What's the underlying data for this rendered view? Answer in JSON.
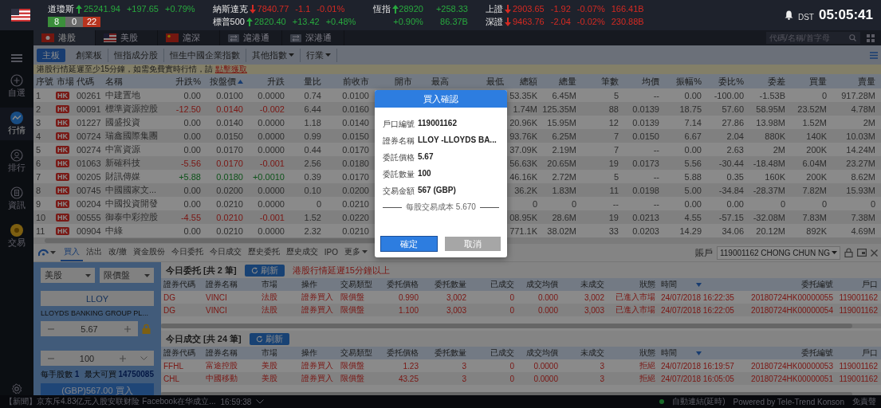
{
  "ticker_columns": [
    {
      "items": [
        {
          "kind": "row",
          "name": "道瓊斯",
          "rising": true,
          "price": "25241.94",
          "change": "+197.65",
          "percent": "+0.79%"
        },
        {
          "kind": "breadth",
          "counts": [
            {
              "value": "8",
              "color": "#3b8f3b"
            },
            {
              "value": "0",
              "color": "#6b6b6b"
            },
            {
              "value": "22",
              "color": "#b8341f"
            }
          ]
        }
      ]
    },
    {
      "items": [
        {
          "kind": "row",
          "name": "納斯達克",
          "rising": false,
          "price": "7840.77",
          "change": "-1.1",
          "percent": "-0.01%"
        },
        {
          "kind": "row",
          "name": "標普500",
          "rising": true,
          "price": "2820.40",
          "change": "+13.42",
          "percent": "+0.48%"
        }
      ]
    },
    {
      "items": [
        {
          "kind": "split",
          "name": "恆指",
          "rising": true,
          "price": "28920",
          "change": "+258.33",
          "percent": "+0.90%",
          "turnover": "86.37B"
        }
      ]
    },
    {
      "items": [
        {
          "kind": "row",
          "name": "上證",
          "rising": false,
          "price": "2903.65",
          "change": "-1.92",
          "percent": "-0.07%",
          "turnover": "166.41B"
        },
        {
          "kind": "row",
          "name": "深證",
          "rising": false,
          "price": "9463.76",
          "change": "-2.04",
          "percent": "-0.02%",
          "turnover": "230.88B"
        }
      ]
    }
  ],
  "clock": {
    "zone": "DST",
    "time": "05:05:41"
  },
  "market_tabs": [
    {
      "label": "港股",
      "kind": "hk",
      "selected": true
    },
    {
      "label": "美股",
      "kind": "us",
      "selected": false
    },
    {
      "label": "滬深",
      "kind": "cn",
      "selected": false
    },
    {
      "label": "滬港通",
      "kind": "connect",
      "selected": false
    },
    {
      "label": "深港通",
      "kind": "connect",
      "selected": false
    }
  ],
  "search": {
    "placeholder": "代碼/名稱/首字母"
  },
  "board_tabs": [
    {
      "label": "主板",
      "selected": true,
      "dropdown": false
    },
    {
      "label": "創業板",
      "selected": false,
      "dropdown": false
    },
    {
      "label": "恒指成分股",
      "selected": false,
      "dropdown": false
    },
    {
      "label": "恒生中國企業指數",
      "selected": false,
      "dropdown": false
    },
    {
      "label": "其他指數",
      "selected": false,
      "dropdown": true
    },
    {
      "label": "行業",
      "selected": false,
      "dropdown": true
    }
  ],
  "notice": {
    "text": "港股行情延遲至少15分鐘，如需免費實時行情，請",
    "link": "點擊獲取"
  },
  "sidebar": {
    "items": [
      {
        "label": "自選",
        "kind": "plus",
        "selected": false
      },
      {
        "label": "行情",
        "kind": "chart",
        "selected": true
      },
      {
        "label": "排行",
        "kind": "user",
        "selected": false
      },
      {
        "label": "資訊",
        "kind": "news",
        "selected": false
      },
      {
        "label": "交易",
        "kind": "coin",
        "selected": false
      }
    ]
  },
  "quotes": {
    "columns": [
      {
        "label": "序號"
      },
      {
        "label": "市場"
      },
      {
        "label": "代碼"
      },
      {
        "label": "名稱"
      },
      {
        "label": "升跌%"
      },
      {
        "label": "按盤價",
        "sorted": true,
        "descending": false
      },
      {
        "label": "升跌"
      },
      {
        "label": "量比"
      },
      {
        "label": "前收市"
      },
      {
        "label": "開市"
      },
      {
        "label": "最高"
      },
      {
        "label": "最低"
      },
      {
        "label": "總額"
      },
      {
        "label": "總量"
      },
      {
        "label": "筆數"
      },
      {
        "label": "均價"
      },
      {
        "label": "振幅%"
      },
      {
        "label": "委比%"
      },
      {
        "label": "委差"
      },
      {
        "label": "買量"
      },
      {
        "label": "賣量"
      }
    ],
    "rows": [
      {
        "rising": false,
        "falling": false,
        "cells": [
          "1",
          "HK",
          "00261",
          "中建置地",
          "0.00",
          "0.0100",
          "0.0000",
          "0.74",
          "0.0100",
          "",
          "",
          "",
          "53.35K",
          "6.45M",
          "5",
          "--",
          "0.00",
          "-100.00",
          "-1.53B",
          "0",
          "917.28M"
        ]
      },
      {
        "rising": false,
        "falling": true,
        "cells": [
          "2",
          "HK",
          "00091",
          "標準資源控股",
          "-12.50",
          "0.0140",
          "-0.002",
          "6.44",
          "0.0160",
          "",
          "",
          "",
          "1.74M",
          "125.35M",
          "88",
          "0.0139",
          "18.75",
          "57.60",
          "58.95M",
          "23.52M",
          "4.78M"
        ]
      },
      {
        "rising": false,
        "falling": false,
        "cells": [
          "3",
          "HK",
          "01227",
          "國盛投資",
          "0.00",
          "0.0140",
          "0.0000",
          "1.18",
          "0.0140",
          "",
          "",
          "",
          "20.96K",
          "15.95M",
          "12",
          "0.0139",
          "7.14",
          "27.86",
          "13.98M",
          "1.52M",
          "2M"
        ]
      },
      {
        "rising": false,
        "falling": false,
        "cells": [
          "4",
          "HK",
          "00724",
          "瑞鑫國際集團",
          "0.00",
          "0.0150",
          "0.0000",
          "0.99",
          "0.0150",
          "",
          "",
          "",
          "93.76K",
          "6.25M",
          "7",
          "0.0150",
          "6.67",
          "2.04",
          "880K",
          "140K",
          "10.03M"
        ]
      },
      {
        "rising": false,
        "falling": false,
        "cells": [
          "5",
          "HK",
          "00274",
          "中富資源",
          "0.00",
          "0.0170",
          "0.0000",
          "0.44",
          "0.0170",
          "",
          "",
          "",
          "37.09K",
          "2.19M",
          "7",
          "--",
          "0.00",
          "2.63",
          "2M",
          "200K",
          "14.24M"
        ]
      },
      {
        "rising": false,
        "falling": true,
        "cells": [
          "6",
          "HK",
          "01063",
          "新確科技",
          "-5.56",
          "0.0170",
          "-0.001",
          "2.56",
          "0.0180",
          "",
          "",
          "",
          "56.63K",
          "20.65M",
          "19",
          "0.0173",
          "5.56",
          "-30.44",
          "-18.48M",
          "6.04M",
          "23.27M"
        ]
      },
      {
        "rising": true,
        "falling": false,
        "cells": [
          "7",
          "HK",
          "00205",
          "財訊傳媒",
          "+5.88",
          "0.0180",
          "+0.0010",
          "0.39",
          "0.0170",
          "",
          "",
          "",
          "46.16K",
          "2.72M",
          "5",
          "--",
          "5.88",
          "0.35",
          "160K",
          "200K",
          "8.62M"
        ]
      },
      {
        "rising": false,
        "falling": false,
        "cells": [
          "8",
          "HK",
          "00745",
          "中國國家文...",
          "0.00",
          "0.0200",
          "0.0000",
          "0.10",
          "0.0200",
          "",
          "",
          "",
          "36.2K",
          "1.83M",
          "11",
          "0.0198",
          "5.00",
          "-34.84",
          "-28.37M",
          "7.82M",
          "15.93M"
        ]
      },
      {
        "rising": false,
        "falling": false,
        "cells": [
          "9",
          "HK",
          "00204",
          "中國投資開發",
          "0.00",
          "0.0210",
          "0.0000",
          "0",
          "0.0210",
          "",
          "",
          "",
          "0",
          "0",
          "--",
          "--",
          "0.00",
          "0.00",
          "0",
          "0",
          "0"
        ]
      },
      {
        "rising": false,
        "falling": true,
        "cells": [
          "10",
          "HK",
          "00555",
          "御泰中彩控股",
          "-4.55",
          "0.0210",
          "-0.001",
          "1.52",
          "0.0220",
          "",
          "",
          "",
          "08.95K",
          "28.6M",
          "19",
          "0.0213",
          "4.55",
          "-57.15",
          "-32.08M",
          "7.83M",
          "7.38M"
        ]
      },
      {
        "rising": false,
        "falling": false,
        "cells": [
          "11",
          "HK",
          "00904",
          "中綠",
          "0.00",
          "0.0210",
          "0.0000",
          "2.32",
          "0.0210",
          "",
          "",
          "",
          "771.1K",
          "38.02M",
          "33",
          "0.0203",
          "14.29",
          "34.06",
          "20.12M",
          "892K",
          "4.69M"
        ]
      }
    ]
  },
  "trade_tabs": [
    {
      "label": "買入",
      "selected": true,
      "dropdown": false
    },
    {
      "label": "沽出",
      "selected": false,
      "dropdown": false
    },
    {
      "label": "改/撤",
      "selected": false,
      "dropdown": false
    },
    {
      "label": "資金股份",
      "selected": false,
      "dropdown": false
    },
    {
      "label": "今日委托",
      "selected": false,
      "dropdown": false
    },
    {
      "label": "今日成交",
      "selected": false,
      "dropdown": false
    },
    {
      "label": "歷史委托",
      "selected": false,
      "dropdown": false
    },
    {
      "label": "歷史成交",
      "selected": false,
      "dropdown": false
    },
    {
      "label": "IPO",
      "selected": false,
      "dropdown": false
    },
    {
      "label": "更多",
      "selected": false,
      "dropdown": true
    }
  ],
  "account": {
    "label": "賬戶",
    "value": "119001162 CHONG CHUN NG"
  },
  "order_form": {
    "market": "美股",
    "order_type": "限價盤",
    "code": "LLOY",
    "name": "LLOYDS BANKING GROUP PL...",
    "price": "5.67",
    "quantity": "100",
    "lot_label": "每手股數",
    "lot": "1",
    "max_label": "最大可買",
    "max": "14750085",
    "submit": "(GBP)567.00 買入"
  },
  "order_sections": [
    {
      "title": "今日委托 [共 2 筆]",
      "refresh": "刷新",
      "note": "港股行情延遲15分鐘以上",
      "columns": [
        {
          "label": "證券代碼"
        },
        {
          "label": "證券名稱"
        },
        {
          "label": "市場"
        },
        {
          "label": "操作"
        },
        {
          "label": "交易類型"
        },
        {
          "label": "委托價格"
        },
        {
          "label": "委托數量"
        },
        {
          "label": "已成交"
        },
        {
          "label": "成交均價"
        },
        {
          "label": "未成交"
        },
        {
          "label": "狀態"
        },
        {
          "label": "時間",
          "sorted": true,
          "descending": true
        },
        {
          "label": "委托編號"
        },
        {
          "label": "戶口"
        }
      ],
      "rows": [
        [
          "DG",
          "VINCI",
          "法股",
          "證券買入",
          "限價盤",
          "0.990",
          "3,002",
          "0",
          "0.000",
          "3,002",
          "已進入市場",
          "24/07/2018 16:22:35",
          "20180724HK00000055",
          "119001162"
        ],
        [
          "DG",
          "VINCI",
          "法股",
          "證券買入",
          "限價盤",
          "1.100",
          "3,003",
          "0",
          "0.000",
          "3,003",
          "已進入市場",
          "24/07/2018 16:22:05",
          "20180724HK00000054",
          "119001162"
        ]
      ]
    },
    {
      "title": "今日成交 [共 24 筆]",
      "refresh": "刷新",
      "columns": [
        {
          "label": "證券代碼"
        },
        {
          "label": "證券名稱"
        },
        {
          "label": "市場"
        },
        {
          "label": "操作"
        },
        {
          "label": "交易類型"
        },
        {
          "label": "委托價格"
        },
        {
          "label": "委托數量"
        },
        {
          "label": "已成交"
        },
        {
          "label": "成交均價"
        },
        {
          "label": "未成交"
        },
        {
          "label": "狀態"
        },
        {
          "label": "時間",
          "sorted": true,
          "descending": true
        },
        {
          "label": "委托編號"
        },
        {
          "label": "戶口"
        }
      ],
      "rows": [
        [
          "FFHL",
          "富途控股",
          "美股",
          "證券買入",
          "限價盤",
          "1.23",
          "3",
          "0",
          "0.0000",
          "3",
          "拒絕",
          "24/07/2018 16:19:57",
          "20180724HK00000053",
          "119001162"
        ],
        [
          "CHL",
          "中國移動",
          "美股",
          "證券買入",
          "限價盤",
          "43.25",
          "3",
          "0",
          "0.0000",
          "3",
          "拒絕",
          "24/07/2018 16:05:05",
          "20180724HK00000051",
          "119001162"
        ]
      ]
    }
  ],
  "status_bar": {
    "news": "【新聞】京东斥4.83亿元入股安联财险 Facebook在华成立...",
    "news_time": "16:59:38",
    "connection": "自動連結(延時)",
    "powered": "Powered by Tele-Trend Konson",
    "disclaimer": "免責聲"
  },
  "modal": {
    "title": "買入確認",
    "fields": [
      {
        "label": "戶口編號",
        "value": "119001162"
      },
      {
        "label": "證券名稱",
        "value": "LLOY -LLOYDS BA..."
      },
      {
        "label": "委託價格",
        "value": "5.67"
      },
      {
        "label": "委託數量",
        "value": "100"
      },
      {
        "label": "交易金額",
        "value": "567 (GBP)"
      }
    ],
    "note": "每股交易成本 5.670",
    "buttons": [
      {
        "label": "確定",
        "kind": "primary"
      },
      {
        "label": "取消",
        "kind": "secondary"
      }
    ]
  }
}
